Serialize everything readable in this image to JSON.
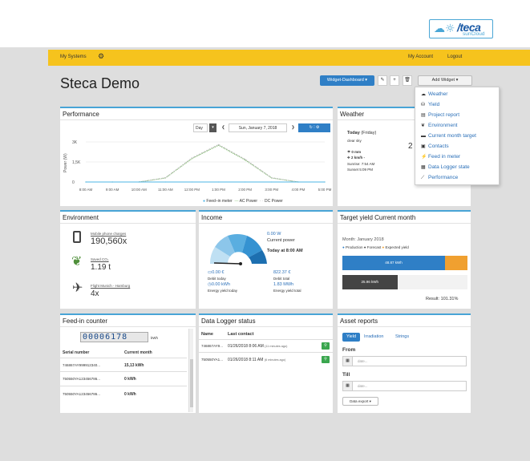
{
  "header": {
    "logo_brand": "/teca",
    "logo_sub": "sunCloud",
    "logo_cloud": "☁☼"
  },
  "nav": {
    "my_systems": "My Systems",
    "my_account": "My Account",
    "logout": "Logout"
  },
  "page_title": "Steca Demo",
  "toolbar": {
    "dashboard_button": "Widget-Dashboard ▾",
    "add_widget": "Add Widget ▾"
  },
  "add_widget_menu": [
    {
      "label": "Weather",
      "icon": "cloud-icon"
    },
    {
      "label": "Yield",
      "icon": "coins-icon"
    },
    {
      "label": "Project report",
      "icon": "document-icon"
    },
    {
      "label": "Environment",
      "icon": "leaf-icon"
    },
    {
      "label": "Current month target",
      "icon": "target-icon"
    },
    {
      "label": "Contacts",
      "icon": "contacts-icon"
    },
    {
      "label": "Feed in meter",
      "icon": "plug-icon"
    },
    {
      "label": "Data Logger state",
      "icon": "logger-icon"
    },
    {
      "label": "Performance",
      "icon": "chart-icon"
    }
  ],
  "performance": {
    "title": "Performance",
    "period": "Day",
    "date": "Sun, January 7, 2018",
    "ylabel": "Power (W)",
    "legend": [
      "Feed–in meter",
      "AC Power",
      "DC Power"
    ]
  },
  "chart_data": {
    "type": "line",
    "ylabel": "Power (W)",
    "xlabel": "",
    "ylim": [
      0,
      3000
    ],
    "yticks": [
      "3K",
      "1,5K",
      "0"
    ],
    "x": [
      "8:00 AM",
      "9:00 AM",
      "10:00 AM",
      "11:00 AM",
      "12:00 PM",
      "1:00 PM",
      "2:00 PM",
      "3:00 PM",
      "4:00 PM",
      "5:00 PM"
    ],
    "series": [
      {
        "name": "AC Power",
        "color": "#8cc47a",
        "values": [
          0,
          0,
          0,
          300,
          1750,
          2750,
          1650,
          300,
          0,
          0
        ]
      },
      {
        "name": "DC Power",
        "color": "#bdbdbd",
        "values": [
          0,
          0,
          0,
          320,
          1800,
          2800,
          1700,
          320,
          0,
          0
        ]
      },
      {
        "name": "Feed–in meter",
        "color": "#4db5e6",
        "values": [
          0,
          0,
          0,
          0,
          0,
          0,
          0,
          0,
          0,
          0
        ]
      }
    ]
  },
  "weather": {
    "title": "Weather",
    "day": "Today",
    "weekday": "(Friday)",
    "cond": "clear sky",
    "rain": "0 mm",
    "wind": "2 km/h -",
    "sunrise": "Sunrise: 7:54 AM",
    "sunset": "Sunset 5:09 PM",
    "temp_partial": "2"
  },
  "environment": {
    "title": "Environment",
    "items": [
      {
        "label": "Mobile phone charges",
        "value": "190,560x",
        "icon": "phone-icon"
      },
      {
        "label": "Saved CO₂",
        "value": "1.19 t",
        "icon": "leaf-icon"
      },
      {
        "label": "Flight Munich - Hamburg",
        "value": "4x",
        "icon": "plane-icon"
      }
    ]
  },
  "income": {
    "title": "Income",
    "power_value": "0.00 W",
    "power_label": "Current power",
    "today_at": "Today at 8:00 AM",
    "debit_today_value": "0.00 €",
    "debit_today_label": "Debit today",
    "debit_total_value": "822.37 €",
    "debit_total_label": "Debit total",
    "yield_today_value": "0.00 kWh",
    "yield_today_label": "Energy yield today",
    "yield_total_value": "1.83 MWh",
    "yield_total_label": "Energy yield total"
  },
  "target": {
    "title": "Target yield Current month",
    "month": "Month: January 2018",
    "legend": [
      "Production",
      "Forecast",
      "Expected yield"
    ],
    "colors": {
      "production": "#2f7fc6",
      "forecast": "#444444",
      "expected": "#f0a030"
    },
    "bar1_label": "48.87 kWh",
    "bar2_label": "25.96 kWh",
    "bar1_fraction": 0.82,
    "bar2_fraction": 0.44,
    "result": "Result: 101.31%"
  },
  "feedin": {
    "title": "Feed-in counter",
    "counter": "00006178",
    "unit": "kWh",
    "headers": [
      "Serial number",
      "Current month"
    ],
    "rows": [
      [
        "746867AY999912340...",
        "15,13 kWh"
      ],
      [
        "750550YA123456786...",
        "0 kWh"
      ],
      [
        "750550YA123456786...",
        "0 kWh"
      ]
    ]
  },
  "logger": {
    "title": "Data Logger status",
    "headers": [
      "Name",
      "Last contact"
    ],
    "rows": [
      {
        "name": "746867AY9...",
        "date": "01/26/2018 8:06 AM",
        "ago": "(11 minutes ago)"
      },
      {
        "name": "750550YA1...",
        "date": "01/26/2018 8:11 AM",
        "ago": "(6 minutes ago)"
      }
    ]
  },
  "asset": {
    "title": "Asset reports",
    "tabs": [
      "Yield",
      "Irradiation",
      "Strings"
    ],
    "from_label": "From",
    "till_label": "Till",
    "date_placeholder": "date...",
    "export": "Data export ▾"
  }
}
